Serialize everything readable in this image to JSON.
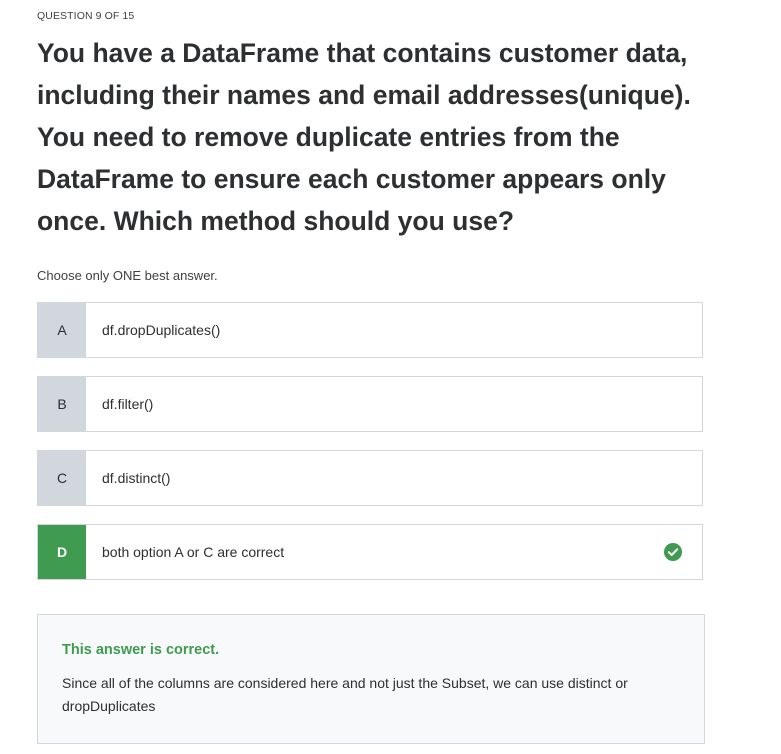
{
  "header": {
    "counter": "QUESTION 9 OF 15"
  },
  "question": {
    "text": "You have a DataFrame that contains customer data, including their names and email addresses(unique). You need to remove duplicate entries from the DataFrame to ensure each customer appears only once. Which method should you use?"
  },
  "instruction": "Choose only ONE best answer.",
  "options": [
    {
      "letter": "A",
      "text": "df.dropDuplicates()",
      "correct": false
    },
    {
      "letter": "B",
      "text": "df.filter()",
      "correct": false
    },
    {
      "letter": "C",
      "text": "df.distinct()",
      "correct": false
    },
    {
      "letter": "D",
      "text": "both option A or C are correct",
      "correct": true
    }
  ],
  "feedback": {
    "title": "This answer is correct.",
    "body": "Since all of the columns are considered here and not just the Subset, we can use distinct or dropDuplicates"
  },
  "colors": {
    "correct_green": "#3f9b4f",
    "letter_gray": "#d1d7dc",
    "feedback_bg": "#f7f9fa"
  },
  "icons": {
    "correct_indicator": "check-circle-icon"
  }
}
